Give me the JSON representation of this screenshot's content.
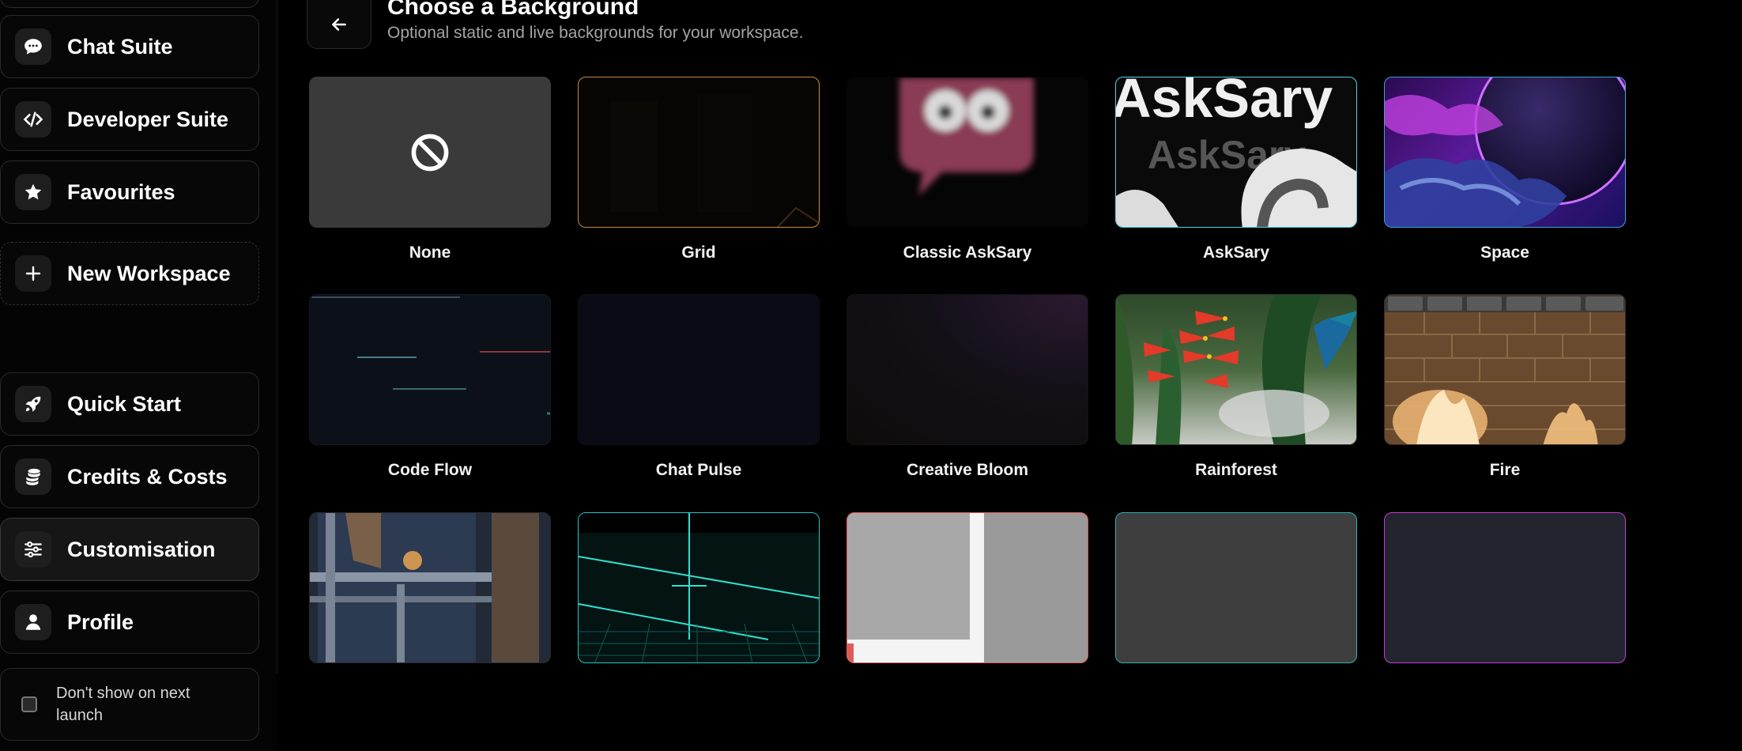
{
  "sidebar": {
    "items": [
      {
        "label": "Chat Suite",
        "icon": "chat-bubble-icon"
      },
      {
        "label": "Developer Suite",
        "icon": "code-icon"
      },
      {
        "label": "Favourites",
        "icon": "star-icon"
      },
      {
        "label": "New Workspace",
        "icon": "plus-icon"
      },
      {
        "label": "Quick Start",
        "icon": "rocket-icon"
      },
      {
        "label": "Credits & Costs",
        "icon": "coins-icon"
      },
      {
        "label": "Customisation",
        "icon": "sliders-icon"
      },
      {
        "label": "Profile",
        "icon": "user-icon"
      }
    ],
    "dont_show_label": "Don't show on next launch"
  },
  "header": {
    "title": "Choose a Background",
    "subtitle": "Optional static and live backgrounds for your workspace."
  },
  "backgrounds": [
    {
      "label": "None"
    },
    {
      "label": "Grid"
    },
    {
      "label": "Classic AskSary"
    },
    {
      "label": "AskSary",
      "overlay_text": "AskSary"
    },
    {
      "label": "Space"
    },
    {
      "label": "Code Flow"
    },
    {
      "label": "Chat Pulse"
    },
    {
      "label": "Creative Bloom"
    },
    {
      "label": "Rainforest"
    },
    {
      "label": "Fire"
    },
    {
      "label": ""
    },
    {
      "label": ""
    },
    {
      "label": ""
    },
    {
      "label": ""
    },
    {
      "label": ""
    }
  ],
  "colors": {
    "grid_border": "#c98a3c",
    "asksary_border": "#4fd2e6",
    "space_border": "#36a5d6",
    "hud_border": "#22c7c7",
    "red_border": "#e05a5a",
    "teal_border": "#2fb3b3",
    "magenta_border": "#c63bd8"
  }
}
